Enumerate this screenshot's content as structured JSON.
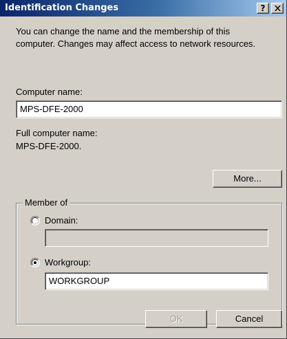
{
  "window": {
    "title": "Identification Changes",
    "help_glyph": "?",
    "close_icon": "close-icon"
  },
  "intro": {
    "line1": "You can change the name and the membership of this",
    "line2": "computer. Changes may affect access to network resources."
  },
  "computer_name": {
    "label": "Computer name:",
    "value": "MPS-DFE-2000"
  },
  "full_name": {
    "label": "Full computer name:",
    "value": "MPS-DFE-2000."
  },
  "more_button": "More...",
  "member_of": {
    "legend": "Member of",
    "domain": {
      "label": "Domain:",
      "selected": false,
      "value": ""
    },
    "workgroup": {
      "label": "Workgroup:",
      "selected": true,
      "value": "WORKGROUP"
    }
  },
  "buttons": {
    "ok": "OK",
    "cancel": "Cancel"
  },
  "colors": {
    "face": "#d4d0c8",
    "title_start": "#0a246a",
    "title_end": "#a6caf0"
  }
}
